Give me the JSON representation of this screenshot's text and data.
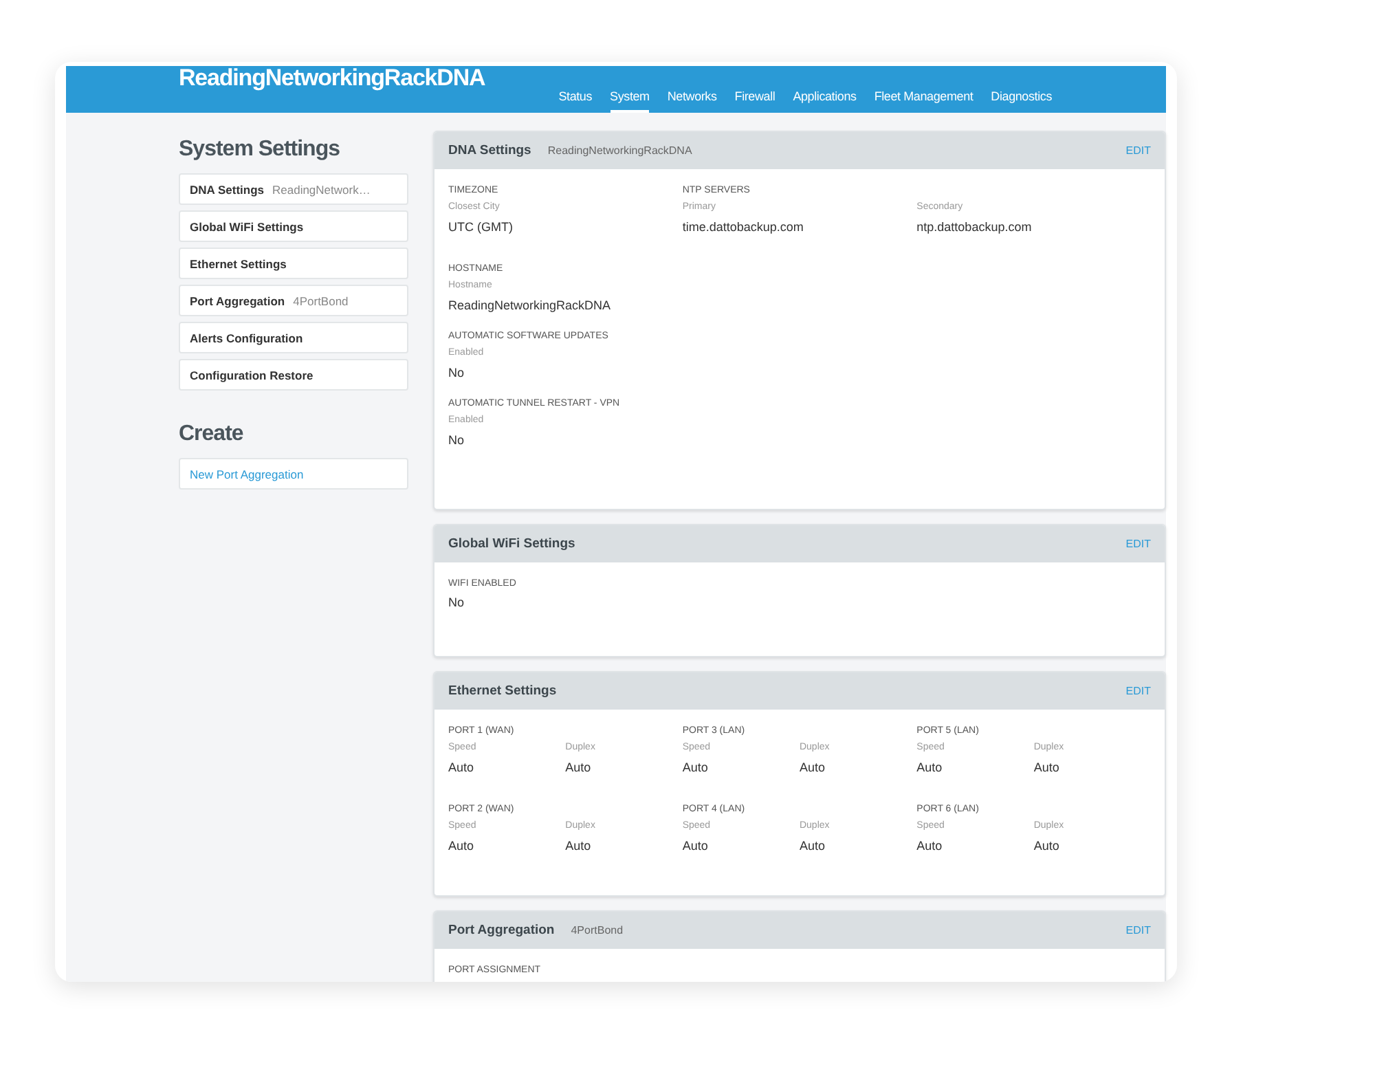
{
  "header": {
    "title": "ReadingNetworkingRackDNA"
  },
  "nav": {
    "tabs": [
      {
        "label": "Status",
        "selected": false
      },
      {
        "label": "System",
        "selected": true
      },
      {
        "label": "Networks",
        "selected": false
      },
      {
        "label": "Firewall",
        "selected": false
      },
      {
        "label": "Applications",
        "selected": false
      },
      {
        "label": "Fleet Management",
        "selected": false
      },
      {
        "label": "Diagnostics",
        "selected": false
      }
    ]
  },
  "sidebar": {
    "sections": [
      {
        "title": "System Settings",
        "kind": "settings",
        "items": [
          {
            "label": "DNA Settings",
            "detail": "ReadingNetwork…"
          },
          {
            "label": "Global WiFi Settings"
          },
          {
            "label": "Ethernet Settings"
          },
          {
            "label": "Port Aggregation",
            "detail": "4PortBond"
          },
          {
            "label": "Alerts Configuration"
          },
          {
            "label": "Configuration Restore"
          }
        ]
      },
      {
        "title": "Create",
        "kind": "links",
        "items": [
          {
            "label": "New Port Aggregation"
          }
        ]
      }
    ]
  },
  "cards": [
    {
      "title": "DNA Settings",
      "subtitle": "ReadingNetworkingRackDNA",
      "action": "EDIT",
      "kind": "details",
      "rows": [
        [
          {
            "heading": "TIMEZONE",
            "fields": [
              {
                "label": "Closest City",
                "value": "UTC (GMT)"
              }
            ]
          },
          {
            "heading": "NTP SERVERS",
            "fields": [
              {
                "label": "Primary",
                "value": "time.dattobackup.com"
              },
              {
                "label": "Secondary",
                "value": "ntp.dattobackup.com"
              }
            ]
          }
        ],
        [
          {
            "heading": "HOSTNAME",
            "fields": [
              {
                "label": "Hostname",
                "value": "ReadingNetworkingRackDNA"
              }
            ]
          }
        ],
        [
          {
            "heading": "AUTOMATIC SOFTWARE UPDATES",
            "fields": [
              {
                "label": "Enabled",
                "value": "No"
              }
            ]
          }
        ],
        [
          {
            "heading": "AUTOMATIC TUNNEL RESTART - VPN",
            "fields": [
              {
                "label": "Enabled",
                "value": "No"
              }
            ]
          }
        ]
      ]
    },
    {
      "title": "Global WiFi Settings",
      "action": "EDIT",
      "kind": "details",
      "rows": [
        [
          {
            "heading": "WIFI ENABLED",
            "fields": [
              {
                "value": "No"
              }
            ]
          }
        ]
      ]
    },
    {
      "title": "Ethernet Settings",
      "action": "EDIT",
      "kind": "ports",
      "rows": [
        [
          {
            "heading": "PORT 1 (WAN)",
            "fields": [
              {
                "label": "Speed",
                "value": "Auto"
              },
              {
                "label": "Duplex",
                "value": "Auto"
              }
            ]
          },
          {
            "heading": "PORT 3 (LAN)",
            "fields": [
              {
                "label": "Speed",
                "value": "Auto"
              },
              {
                "label": "Duplex",
                "value": "Auto"
              }
            ]
          },
          {
            "heading": "PORT 5 (LAN)",
            "fields": [
              {
                "label": "Speed",
                "value": "Auto"
              },
              {
                "label": "Duplex",
                "value": "Auto"
              }
            ]
          }
        ],
        [
          {
            "heading": "PORT 2 (WAN)",
            "fields": [
              {
                "label": "Speed",
                "value": "Auto"
              },
              {
                "label": "Duplex",
                "value": "Auto"
              }
            ]
          },
          {
            "heading": "PORT 4 (LAN)",
            "fields": [
              {
                "label": "Speed",
                "value": "Auto"
              },
              {
                "label": "Duplex",
                "value": "Auto"
              }
            ]
          },
          {
            "heading": "PORT 6 (LAN)",
            "fields": [
              {
                "label": "Speed",
                "value": "Auto"
              },
              {
                "label": "Duplex",
                "value": "Auto"
              }
            ]
          }
        ]
      ]
    },
    {
      "title": "Port Aggregation",
      "subtitle": "4PortBond",
      "action": "EDIT",
      "kind": "details",
      "rows": [
        [
          {
            "heading": "PORT ASSIGNMENT"
          }
        ]
      ]
    }
  ]
}
